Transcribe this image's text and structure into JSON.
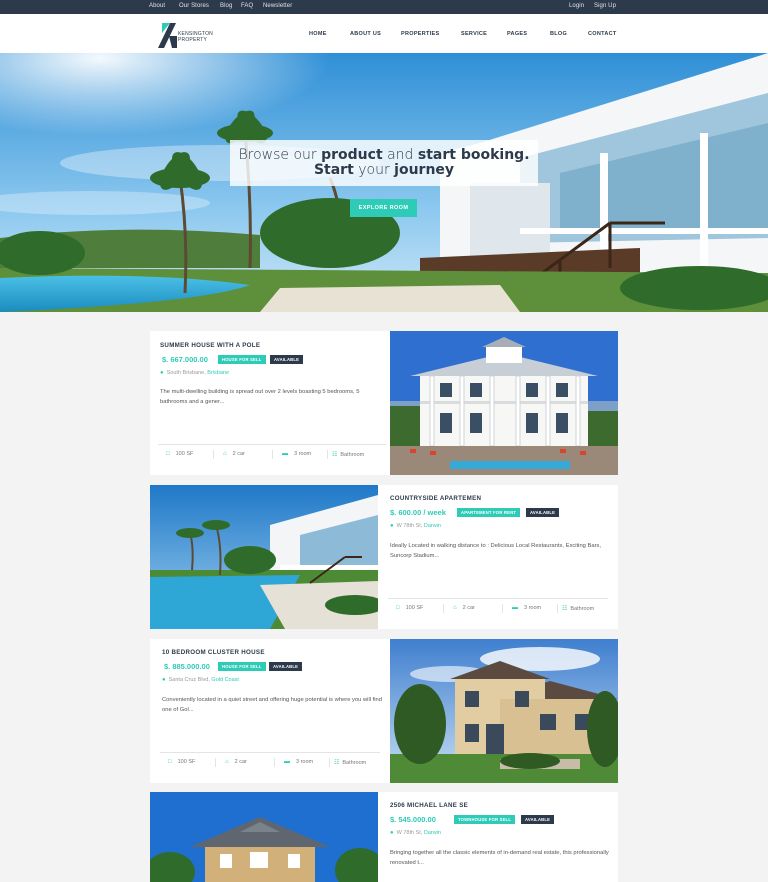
{
  "topbar": {
    "left_links": [
      "About",
      "Our Stores",
      "Blog",
      "FAQ",
      "Newsletter"
    ],
    "right_links": [
      "Login",
      "Sign Up"
    ]
  },
  "brand": {
    "line1": "KENSINGTON",
    "line2": "PROPERTY"
  },
  "nav": [
    "HOME",
    "ABOUT US",
    "PROPERTIES",
    "SERVICE",
    "PAGES",
    "BLOG",
    "CONTACT"
  ],
  "hero": {
    "line1_a": "Browse our ",
    "line1_b": "product",
    "line1_c": " and ",
    "line1_d": "start booking.",
    "line2_a": "Start",
    "line2_b": " your ",
    "line2_c": "journey",
    "button": "EXPLORE ROOM"
  },
  "listings": [
    {
      "title": "SUMMER HOUSE WITH A POLE",
      "price": "$. 667.000.00",
      "badge1": "HOUSE FOR SELL",
      "badge2": "AVAILABLE",
      "street": "South Brisbane, ",
      "city": "Brisbane",
      "desc": "The multi-dwelling building is spread out over 2 levels boasting 5 bedrooms, 5 bathrooms and a gener...",
      "area": "100 SF",
      "car": "2 car",
      "rooms": "3 room",
      "bath": "Bathroom"
    },
    {
      "title": "COUNTRYSIDE APARTEMEN",
      "price": "$. 600.00 / week",
      "badge1": "APARTEMENT FOR RENT",
      "badge2": "AVAILABLE",
      "street": "W 78th St, ",
      "city": "Darwin",
      "desc": "Ideally Located in walking distance to : Delicious Local Restaurants, Exciting Bars, Suncorp Stadium...",
      "area": "100 SF",
      "car": "2 car",
      "rooms": "3 room",
      "bath": "Bathroom"
    },
    {
      "title": "10 BEDROOM CLUSTER HOUSE",
      "price": "$. 885.000.00",
      "badge1": "HOUSE FOR SELL",
      "badge2": "AVAILABLE",
      "street": "Santa Cruz Blvd, ",
      "city": "Gold Coast",
      "desc": "Conveniently located in a quiet street and offering huge potential is where you will find one of Gol...",
      "area": "100 SF",
      "car": "2 car",
      "rooms": "3 room",
      "bath": "Bathroom"
    },
    {
      "title": "2506 MICHAEL LANE SE",
      "price": "$. 545.000.00",
      "badge1": "TOWNHOUSE FOR SELL",
      "badge2": "AVAILABLE",
      "street": "W 78th St, ",
      "city": "Darwin",
      "desc": "Bringing together all the classic elements of in-demand real estate, this professionally renovated t..."
    }
  ],
  "colors": {
    "accent": "#2ecbb6",
    "dark": "#2c3a4b",
    "background": "#f3f3f3"
  }
}
